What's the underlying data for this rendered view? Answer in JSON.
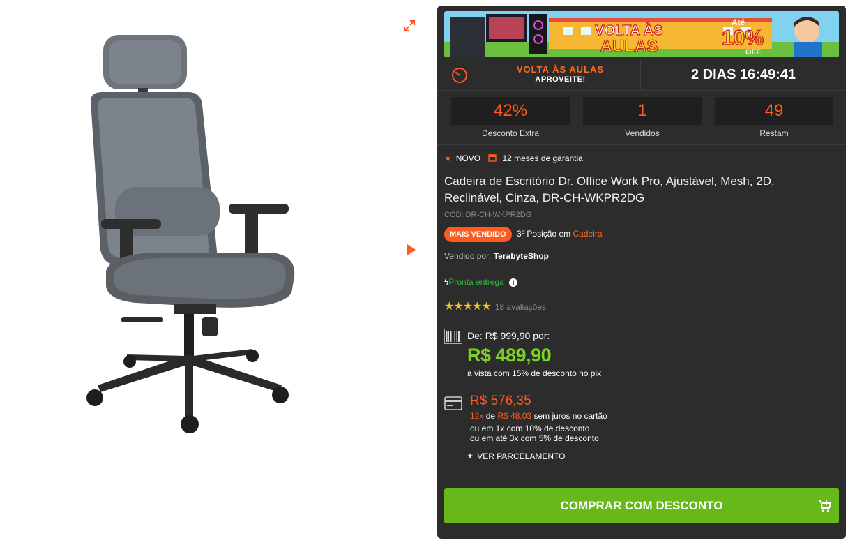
{
  "banner": {
    "text_line1": "VOLTA ÀS",
    "text_line2": "AULAS",
    "offer_prefix": "Até",
    "offer_value": "10%",
    "offer_suffix": "OFF"
  },
  "promo": {
    "title": "VOLTA ÀS AULAS",
    "subtitle": "APROVEITE!",
    "countdown": "2 DIAS 16:49:41"
  },
  "stats": [
    {
      "value": "42%",
      "label": "Desconto Extra"
    },
    {
      "value": "1",
      "label": "Vendidos"
    },
    {
      "value": "49",
      "label": "Restam"
    }
  ],
  "product": {
    "condition": "NOVO",
    "warranty": "12 meses de garantia",
    "title": "Cadeira de Escritório Dr. Office Work Pro, Ajustável, Mesh, 2D, Reclinável, Cinza, DR-CH-WKPR2DG",
    "sku": "CÓD: DR-CH-WKPR2DG",
    "best_seller_badge": "MAIS VENDIDO",
    "rank_text": "3º Posição em",
    "rank_category": "Cadeira",
    "seller_label": "Vendido por:",
    "seller_name": "TerabyteShop",
    "availability": "Pronta entrega",
    "rating_stars": "★★★★★",
    "rating_count": "18 avaliações"
  },
  "pricing": {
    "from_label": "De:",
    "old_price": "R$ 999,90",
    "for_label": "por:",
    "pix_price": "R$ 489,90",
    "pix_note": "à vista com 15% de desconto no pix",
    "card_price": "R$ 576,35",
    "installments": "12x",
    "installments_of": "de",
    "installment_value": "R$ 48,03",
    "installment_suffix": "sem juros no cartão",
    "option_1x": "ou em 1x com 10% de desconto",
    "option_3x": "ou em até 3x com 5% de desconto",
    "see_installments": "VER PARCELAMENTO"
  },
  "cta": {
    "buy_label": "COMPRAR COM DESCONTO"
  },
  "colors": {
    "accent": "#ff5a1f",
    "green": "#67b91a",
    "panel": "#2c2c2c"
  }
}
